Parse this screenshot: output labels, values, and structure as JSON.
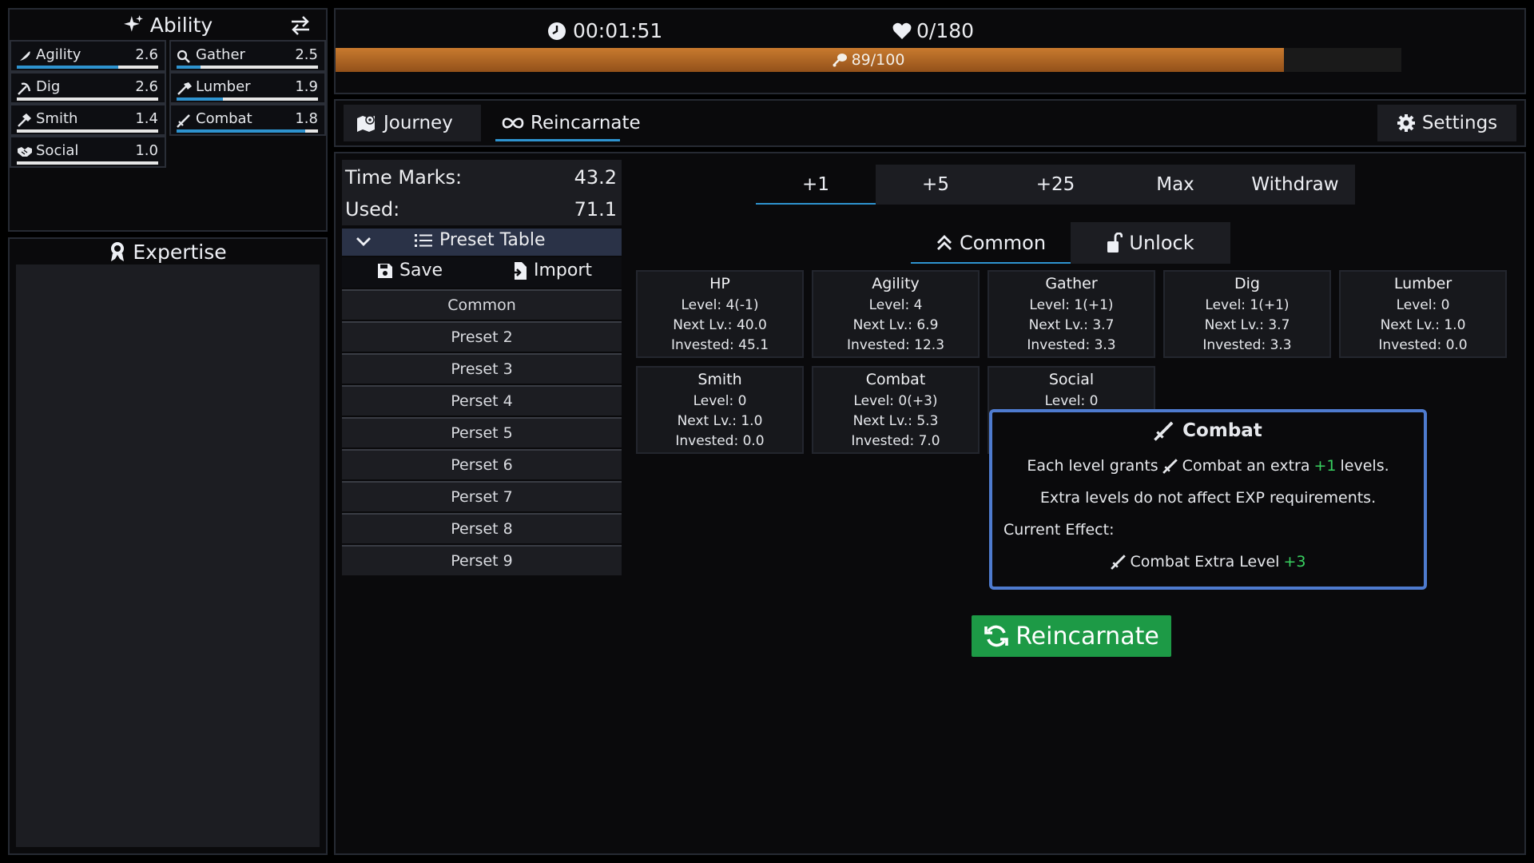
{
  "ability": {
    "title": "Ability",
    "items": [
      {
        "name": "Agility",
        "value": "2.6",
        "progress": 0.72
      },
      {
        "name": "Gather",
        "value": "2.5",
        "progress": 0.17
      },
      {
        "name": "Dig",
        "value": "2.6",
        "progress": 0.0
      },
      {
        "name": "Lumber",
        "value": "1.9",
        "progress": 0.33
      },
      {
        "name": "Smith",
        "value": "1.4",
        "progress": 0.0
      },
      {
        "name": "Combat",
        "value": "1.8",
        "progress": 0.91
      },
      {
        "name": "Social",
        "value": "1.0",
        "progress": 0.0
      }
    ]
  },
  "expertise": {
    "title": "Expertise"
  },
  "status": {
    "timer": "00:01:51",
    "hp": "0/180",
    "stamina_label": "89/100",
    "stamina_fraction": 0.89
  },
  "tabs": {
    "journey": "Journey",
    "reincarnate": "Reincarnate",
    "settings": "Settings"
  },
  "marks": {
    "time_marks_label": "Time Marks:",
    "time_marks_value": "43.2",
    "used_label": "Used:",
    "used_value": "71.1"
  },
  "presets": {
    "title": "Preset Table",
    "save": "Save",
    "import": "Import",
    "items": [
      "Common",
      "Preset 2",
      "Preset 3",
      "Perset 4",
      "Perset 5",
      "Perset 6",
      "Perset 7",
      "Perset 8",
      "Perset 9"
    ]
  },
  "increments": {
    "active": "+1",
    "items": [
      "+1",
      "+5",
      "+25",
      "Max",
      "Withdraw"
    ]
  },
  "categories": {
    "common": "Common",
    "unlock": "Unlock"
  },
  "stats": [
    {
      "name": "HP",
      "level": "Level: 4(-1)",
      "next": "Next Lv.: 40.0",
      "invested": "Invested: 45.1"
    },
    {
      "name": "Agility",
      "level": "Level: 4",
      "next": "Next Lv.: 6.9",
      "invested": "Invested: 12.3"
    },
    {
      "name": "Gather",
      "level": "Level: 1(+1)",
      "next": "Next Lv.: 3.7",
      "invested": "Invested: 3.3"
    },
    {
      "name": "Dig",
      "level": "Level: 1(+1)",
      "next": "Next Lv.: 3.7",
      "invested": "Invested: 3.3"
    },
    {
      "name": "Lumber",
      "level": "Level: 0",
      "next": "Next Lv.: 1.0",
      "invested": "Invested: 0.0"
    },
    {
      "name": "Smith",
      "level": "Level: 0",
      "next": "Next Lv.: 1.0",
      "invested": "Invested: 0.0"
    },
    {
      "name": "Combat",
      "level": "Level: 0(+3)",
      "next": "Next Lv.: 5.3",
      "invested": "Invested: 7.0"
    },
    {
      "name": "Social",
      "level": "Level: 0",
      "next": "",
      "invested": ""
    }
  ],
  "tooltip": {
    "title": "Combat",
    "line1_a": "Each level grants",
    "line1_b": "Combat an extra",
    "line1_bonus": "+1",
    "line1_c": "levels.",
    "line2": "Extra levels do not affect EXP requirements.",
    "current_label": "Current Effect:",
    "effect_label": "Combat Extra Level",
    "effect_value": "+3"
  },
  "reincarnate_button": "Reincarnate",
  "colors": {
    "accent": "#2e93cf",
    "panel_border": "#262a33",
    "bonus_green": "#38d160",
    "button_green": "#1d9a46",
    "tooltip_border": "#4e7bcf",
    "stamina": "#b8692a"
  }
}
